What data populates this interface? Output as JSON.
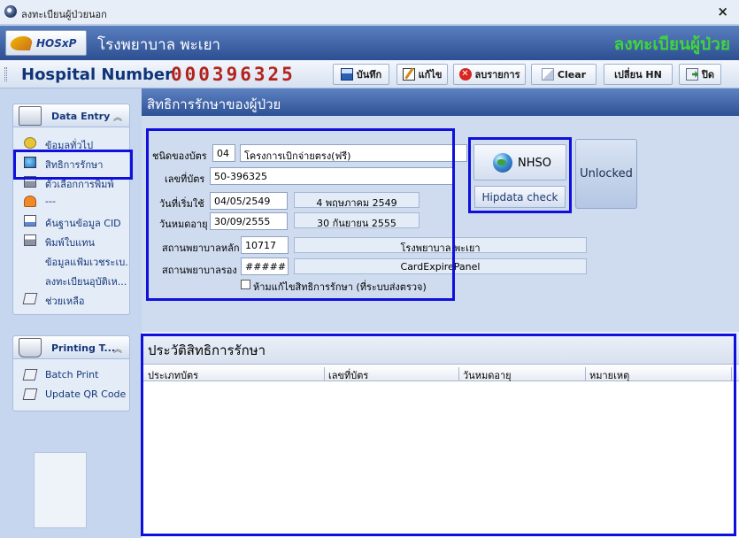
{
  "window": {
    "title": "ลงทะเบียนผู้ป่วยนอก",
    "close_glyph": "×"
  },
  "banner": {
    "logo_text": "HOSxP",
    "hospital_name": "โรงพยาบาล พะเยา",
    "page_title": "ลงทะเบียนผู้ป่วย"
  },
  "toolbar": {
    "hn_label": "Hospital Number",
    "hn_value": "000396325",
    "buttons": [
      {
        "label": "บันทึก",
        "icon": "save-icon"
      },
      {
        "label": "แก้ไข",
        "icon": "edit-icon"
      },
      {
        "label": "ลบรายการ",
        "icon": "delete-icon"
      },
      {
        "label": "Clear",
        "icon": "clear-icon"
      },
      {
        "label": "เปลี่ยน HN",
        "icon": ""
      },
      {
        "label": "ปิด",
        "icon": "exit-icon"
      }
    ]
  },
  "sidebar": {
    "data_entry": {
      "title": "Data Entry",
      "items": [
        {
          "label": "ข้อมูลทั่วไป",
          "icon": "info-icon"
        },
        {
          "label": "สิทธิการรักษา",
          "icon": "globe-icon"
        },
        {
          "label": "ตัวเลือกการพิมพ์",
          "icon": "print-icon"
        },
        {
          "label": "---",
          "icon": "users-icon"
        },
        {
          "label": "ค้นฐานข้อมูล CID",
          "icon": "doc-icon"
        },
        {
          "label": "พิมพ์ใบแทน",
          "icon": "print-icon"
        },
        {
          "label": "ข้อมูลแฟ้มเวชระเบ...",
          "icon": ""
        },
        {
          "label": "ลงทะเบียนอุบัติเห...",
          "icon": ""
        },
        {
          "label": "ช่วยเหลือ",
          "icon": "card-icon"
        }
      ]
    },
    "printing": {
      "title": "Printing T...",
      "items": [
        {
          "label": "Batch Print",
          "icon": "card-icon"
        },
        {
          "label": "Update QR Code",
          "icon": "card-icon"
        }
      ]
    }
  },
  "content": {
    "title": "สิทธิการรักษาของผู้ป่วย",
    "form": {
      "card_type_label": "ชนิดของบัตร",
      "card_type_code": "04",
      "card_type_name": "โครงการเบิกจ่ายตรง(ฟรี)",
      "card_no_label": "เลขที่บัตร",
      "card_no": "50-396325",
      "start_label": "วันที่เริ่มใช้",
      "start_date": "04/05/2549",
      "start_date_text": "4 พฤษภาคม 2549",
      "expire_label": "วันหมดอายุ",
      "expire_date": "30/09/2555",
      "expire_date_text": "30 กันยายน 2555",
      "main_hosp_label": "สถานพยาบาลหลัก",
      "main_hosp_code": "10717",
      "main_hosp_name": "โรงพยาบาล พะเยา",
      "sub_hosp_label": "สถานพยาบาลรอง",
      "sub_hosp_code": "#####",
      "sub_hosp_name": "CardExpirePanel",
      "lock_checkbox_label": "ห้ามแก้ไขสิทธิการรักษา (ที่ระบบส่งตรวจ)",
      "lock_checked": false
    },
    "nhso_button": "NHSO",
    "hipdata_button": "Hipdata check",
    "unlock_button": "Unlocked"
  },
  "history": {
    "title": "ประวัติสิทธิการรักษา",
    "columns": [
      "ประเภทบัตร",
      "เลขที่บัตร",
      "วันหมดอายุ",
      "หมายเหตุ"
    ],
    "rows": []
  },
  "colors": {
    "highlight_border": "#1010dd",
    "hn_value": "#b3231c",
    "page_title": "#3fd33f",
    "header_blue": "#2e5196"
  }
}
